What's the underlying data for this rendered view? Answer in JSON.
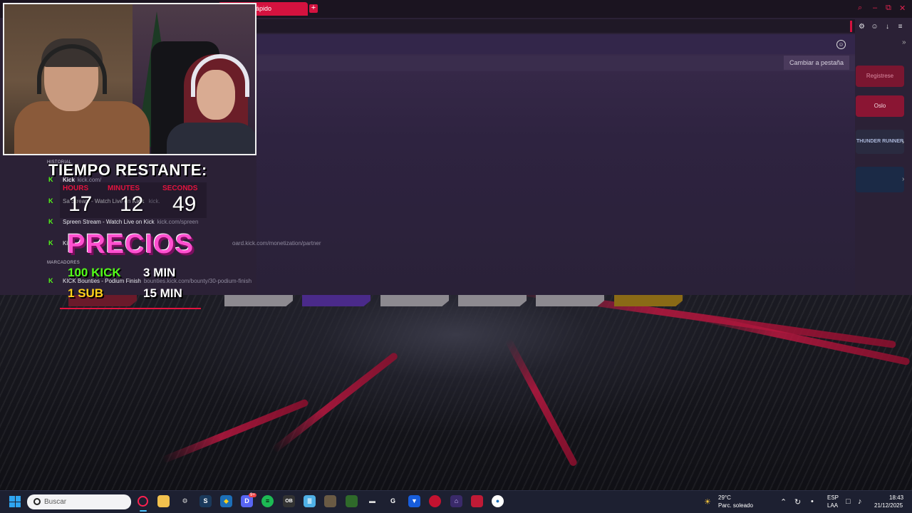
{
  "browser": {
    "active_tab_label": "rápido",
    "new_tab_symbol": "+",
    "switch_tab_label": "Cambiar a pestaña"
  },
  "bookmarks": {
    "items": [
      {
        "title": "Kick",
        "url": "kick.com/"
      },
      {
        "title": "Spreen Stream - Watch Live on Kick",
        "url": "kick.com/spreen"
      },
      {
        "title": "KICK Bounties - Podium Finish",
        "url": "bounties.kick.com/bounty/30-podium-finish"
      }
    ],
    "partial_row": {
      "title_prefix": "Sa",
      "title_mid": "Stream - Watch Live on",
      "title_kick": "Kick",
      "url_fragment": "kick."
    },
    "dashboard_url": "oard.kick.com/monetization/partner",
    "dashboard_title_prefix": "Ki",
    "section_label_top": "HISTORIAL",
    "section_label": "MARCADORES"
  },
  "sidebar": {
    "items": [
      {
        "label": "Registrese"
      },
      {
        "label": "Oslo"
      },
      {
        "label": "THUNDER RUNNER"
      }
    ]
  },
  "overlay": {
    "title": "TIEMPO RESTANTE:",
    "timer": {
      "labels": [
        "HOURS",
        "MINUTES",
        "SECONDS"
      ],
      "hours": "17",
      "minutes": "12",
      "seconds": "49"
    },
    "precios_title": "PRECIOS",
    "prices": [
      {
        "amount": "100 KICK",
        "duration": "3 MIN"
      },
      {
        "amount": "1 SUB",
        "duration": "15 MIN"
      }
    ]
  },
  "taskbar": {
    "search_placeholder": "Buscar",
    "weather_temp": "29°C",
    "weather_desc": "Parc. soleado",
    "lang_top": "ESP",
    "lang_bottom": "LAA",
    "time": "18:43",
    "date": "21/12/2025",
    "discord_badge": "9+"
  },
  "colors": {
    "accent": "#d4123f",
    "kick_green": "#53fc18",
    "precios_pink": "#ff4fcf",
    "timer_red": "#e3133f"
  }
}
